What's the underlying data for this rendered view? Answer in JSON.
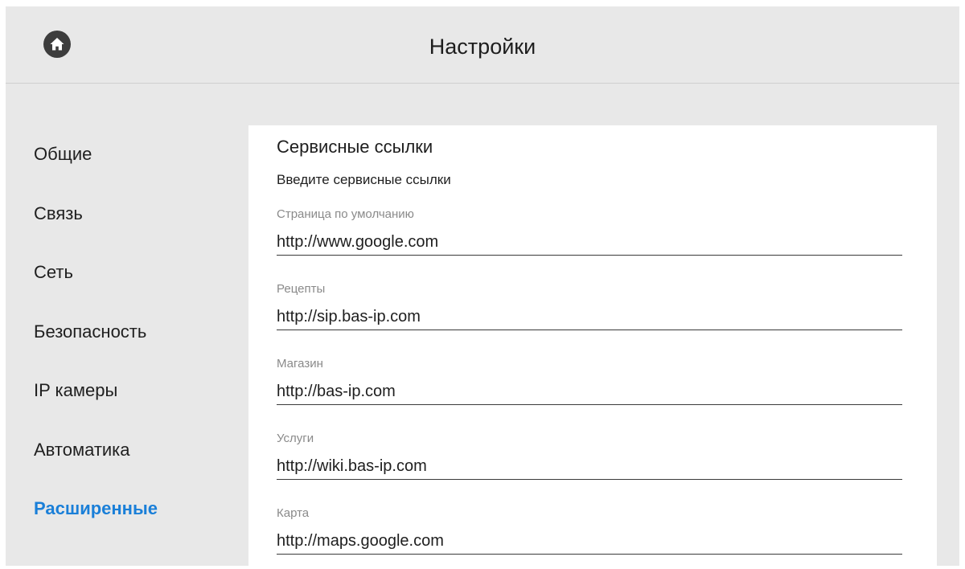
{
  "header": {
    "title": "Настройки",
    "home_icon": "home-icon"
  },
  "sidebar": {
    "items": [
      {
        "label": "Общие",
        "active": false
      },
      {
        "label": "Связь",
        "active": false
      },
      {
        "label": "Сеть",
        "active": false
      },
      {
        "label": "Безопасность",
        "active": false
      },
      {
        "label": "IP камеры",
        "active": false
      },
      {
        "label": "Автоматика",
        "active": false
      },
      {
        "label": "Расширенные",
        "active": true
      }
    ]
  },
  "panel": {
    "title": "Сервисные ссылки",
    "subtitle": "Введите сервисные ссылки",
    "fields": [
      {
        "label": "Страница по умолчанию",
        "value": "http://www.google.com"
      },
      {
        "label": "Рецепты",
        "value": "http://sip.bas-ip.com"
      },
      {
        "label": "Магазин",
        "value": "http://bas-ip.com"
      },
      {
        "label": "Услуги",
        "value": "http://wiki.bas-ip.com"
      },
      {
        "label": "Карта",
        "value": "http://maps.google.com"
      }
    ]
  },
  "colors": {
    "background": "#e8e8e8",
    "panel": "#ffffff",
    "accent": "#1a7fd8",
    "text": "#1e1e1e",
    "label": "#8a8a8a"
  }
}
